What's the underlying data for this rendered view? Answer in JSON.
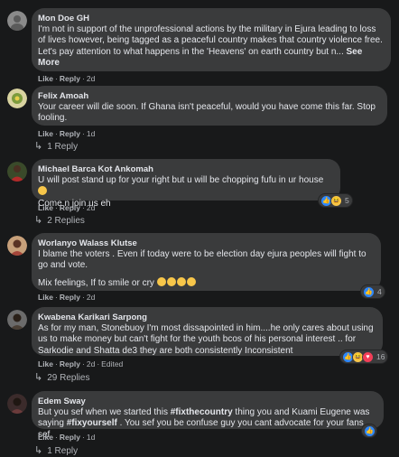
{
  "actions": {
    "like": "Like",
    "reply": "Reply",
    "dot": "·",
    "edited": "Edited"
  },
  "comments": [
    {
      "name": "Mon Doe GH",
      "text": "I'm not in support of the unprofessional actions by the military in Ejura leading to loss of lives however, being tagged as a peaceful country makes that country violence free. Let's pay attention to what happens in the 'Heavens' on earth country but n...",
      "see_more": "See More",
      "time": "2d",
      "avatar_color": "#8a8a8a"
    },
    {
      "name": "Felix Amoah",
      "text": "Your career will die soon. If Ghana isn't peaceful, would you have come this far. Stop fooling.",
      "time": "1d",
      "replies": "1 Reply",
      "avatar_color": "#d9d3a0"
    },
    {
      "name": "Michael Barca Kot Ankomah",
      "text": "U will post stand up for your right but u will be chopping fufu in ur house",
      "text2": "Come n join us eh",
      "time": "2d",
      "replies": "2 Replies",
      "reaction_count": "5",
      "avatar_color": "#b22a2a"
    },
    {
      "name": "Worlanyo Walass Klutse",
      "text": "I blame the voters . Even if today were to be election day ejura peoples will fight to go and vote.",
      "text2": "Mix feelings, If to smile or cry",
      "time": "2d",
      "reaction_count": "4",
      "avatar_color": "#a5463a"
    },
    {
      "name": "Kwabena Karikari Sarpong",
      "text": "As for my man, Stonebuoy I'm most dissapointed in him....he only cares about using us to make money but can't fight for the youth bcos of his personal interest .. for Sarkodie and Shatta de3 they are both consistently Inconsistent",
      "time": "2d",
      "edited": true,
      "replies": "29 Replies",
      "reaction_count": "16",
      "avatar_color": "#4a3f35"
    },
    {
      "name": "Edem Sway",
      "text_a": "But you sef when we started this ",
      "hashtag1": "#fixthecountry",
      "text_b": " thing you and Kuami Eugene was saying ",
      "hashtag2": "#fixyourself",
      "text_c": " . You sef you be confuse guy you cant advocate for your fans sef",
      "time": "1d",
      "replies": "1 Reply",
      "avatar_color": "#6b3b3b"
    }
  ]
}
